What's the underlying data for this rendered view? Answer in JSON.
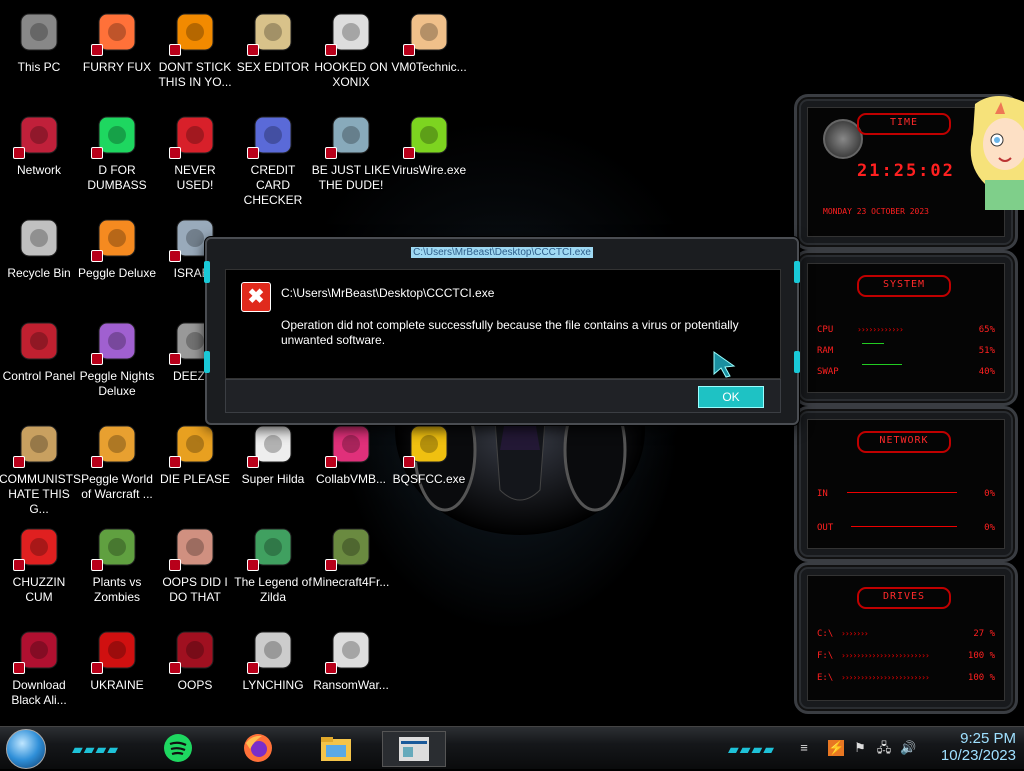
{
  "desktop_icons": [
    {
      "label": "This PC",
      "icon": "monitor-icon"
    },
    {
      "label": "FURRY FUX",
      "icon": "firefox-icon"
    },
    {
      "label": "DONT STICK THIS IN YO...",
      "icon": "vlc-cone-icon"
    },
    {
      "label": "SEX EDITOR",
      "icon": "hxd-editor-icon"
    },
    {
      "label": "HOOKED ON XONIX",
      "icon": "xonix-game-icon"
    },
    {
      "label": "VM0Technic...",
      "icon": "technician-icon"
    },
    {
      "label": "Network",
      "icon": "network-alien-icon"
    },
    {
      "label": "D FOR DUMBASS",
      "icon": "spotify-icon"
    },
    {
      "label": "NEVER USED!",
      "icon": "dev-cpp-icon"
    },
    {
      "label": "CREDIT CARD CHECKER",
      "icon": "credit-card-icon"
    },
    {
      "label": "BE JUST LIKE THE DUDE!",
      "icon": "gnome-icon"
    },
    {
      "label": "VirusWire.exe",
      "icon": "limewire-icon"
    },
    {
      "label": "Recycle Bin",
      "icon": "recycle-bin-icon"
    },
    {
      "label": "Peggle Deluxe",
      "icon": "peggle-icon"
    },
    {
      "label": "ISRAEL",
      "icon": "network-cable-icon"
    },
    {
      "label": "Control Panel",
      "icon": "control-panel-icon"
    },
    {
      "label": "Peggle Nights Deluxe",
      "icon": "peggle-nights-icon"
    },
    {
      "label": "DEEZ N",
      "icon": "copy-windows-icon"
    },
    {
      "label": "COMMUNISTS HATE THIS G...",
      "icon": "money-bag-icon"
    },
    {
      "label": "Peggle World of Warcraft ...",
      "icon": "peggle-wow-icon"
    },
    {
      "label": "DIE PLEASE",
      "icon": "director-icon"
    },
    {
      "label": "Super Hilda",
      "icon": "hilda-icon"
    },
    {
      "label": "CollabVMB...",
      "icon": "collabvm-icon"
    },
    {
      "label": "BQSFCC.exe",
      "icon": "briefcase-lock-icon"
    },
    {
      "label": "CHUZZIN CUM",
      "icon": "chuzzle-icon"
    },
    {
      "label": "Plants vs Zombies",
      "icon": "pvz-icon"
    },
    {
      "label": "OOPS DID I DO THAT",
      "icon": "portrait-icon"
    },
    {
      "label": "The Legend of Zilda",
      "icon": "link-sprite-icon"
    },
    {
      "label": "Minecraft4Fr...",
      "icon": "minecraft-icon"
    },
    {
      "label": "Download Black Ali...",
      "icon": "alien-icon"
    },
    {
      "label": "UKRAINE",
      "icon": "radiation-icon"
    },
    {
      "label": "OOPS",
      "icon": "alienware-laptop-icon"
    },
    {
      "label": "LYNCHING",
      "icon": "network-tree-icon"
    },
    {
      "label": "RansomWar...",
      "icon": "skull-ring-icon"
    }
  ],
  "dialog": {
    "title": "C:\\Users\\MrBeast\\Desktop\\CCCTCI.exe",
    "path": "C:\\Users\\MrBeast\\Desktop\\CCCTCI.exe",
    "message": "Operation did not complete successfully because the file contains a virus or potentially unwanted software.",
    "ok_label": "OK"
  },
  "gadget": {
    "time_title": "TIME",
    "time_value": "21:25:02",
    "date_value": "MONDAY 23 OCTOBER 2023",
    "system_title": "SYSTEM",
    "system_rows": [
      {
        "key": "CPU",
        "value": "65%"
      },
      {
        "key": "RAM",
        "value": "51%"
      },
      {
        "key": "SWAP",
        "value": "40%"
      }
    ],
    "network_title": "NETWORK",
    "network_rows": [
      {
        "key": "IN",
        "value": "0%"
      },
      {
        "key": "OUT",
        "value": "0%"
      }
    ],
    "drives_title": "DRIVES",
    "drive_rows": [
      {
        "key": "C:\\",
        "value": "27 %"
      },
      {
        "key": "F:\\",
        "value": "100 %"
      },
      {
        "key": "E:\\",
        "value": "100 %"
      }
    ]
  },
  "taskbar": {
    "apps": [
      "spotify-icon",
      "firefox-icon",
      "file-explorer-icon",
      "window-preview-icon"
    ],
    "clock_time": "9:25 PM",
    "clock_date": "10/23/2023"
  },
  "colors": {
    "accent_cyan": "#1ec2c4",
    "gadget_red": "#ff2020",
    "error_red": "#e02a1c"
  }
}
